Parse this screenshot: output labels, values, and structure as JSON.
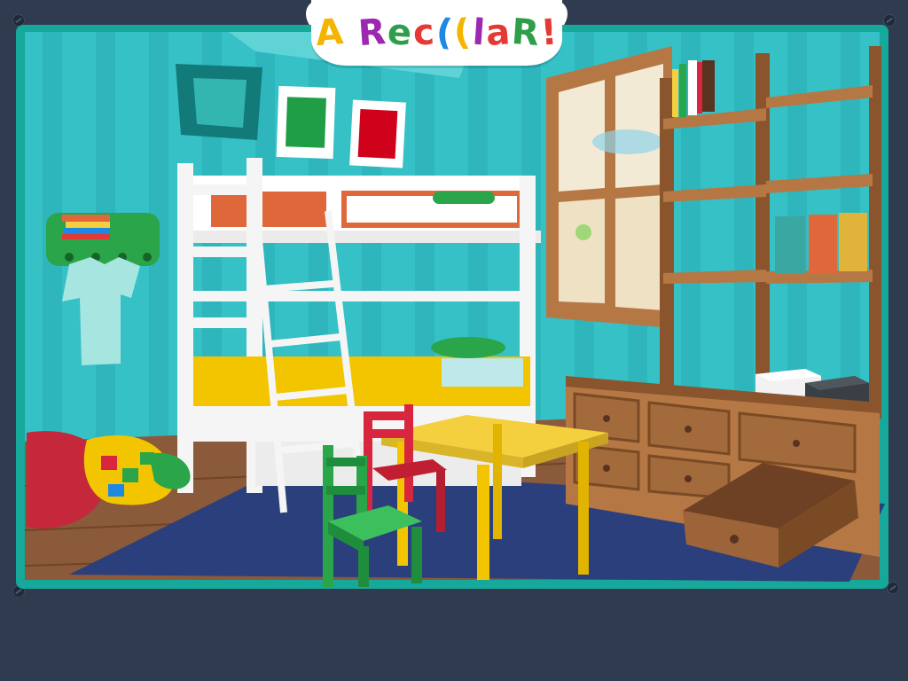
{
  "app": {
    "title": "A RECICLAR!",
    "title_letters": [
      "A",
      " ",
      "R",
      "e",
      "c",
      "(",
      "(",
      "l",
      "a",
      "R",
      "!"
    ],
    "title_colors": [
      "#f4b400",
      "#ffffff",
      "#9c27b0",
      "#2e9e4a",
      "#e53935",
      "#1e88e5",
      "#f4b400",
      "#9c27b0",
      "#e53935",
      "#2e9e4a",
      "#e53935"
    ]
  },
  "scene": {
    "name": "bedroom",
    "colors": {
      "frame": "#16a89a",
      "wall": "#35c1c6",
      "wall_stripe": "#2cb2b8",
      "floor": "#8a5a3a",
      "rug": "#2b3f7d",
      "wood": "#b57845",
      "bunk": "#f5f5f5",
      "blanket_yellow": "#f2c500",
      "pillow_orange": "#e0673a",
      "pillow_green": "#2aa54a",
      "table_yellow": "#f4d03f",
      "chair_red": "#d7263d",
      "chair_green": "#2aa54a",
      "poster_green": "#1f9e45",
      "poster_red": "#d0021b"
    }
  }
}
